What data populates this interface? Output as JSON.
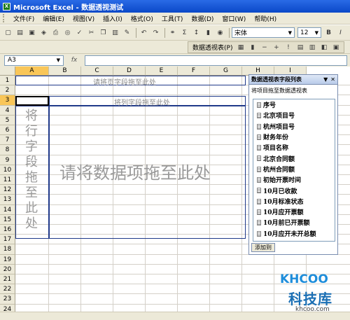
{
  "window": {
    "title": "Microsoft Excel - 数据透视测试"
  },
  "menu": [
    "文件(F)",
    "编辑(E)",
    "视图(V)",
    "插入(I)",
    "格式(O)",
    "工具(T)",
    "数据(D)",
    "窗口(W)",
    "帮助(H)"
  ],
  "toolbar": {
    "font_name": "宋体",
    "font_size": "12",
    "bold": "B",
    "italic": "I",
    "sum": "Σ"
  },
  "pivot_toolbar": {
    "label": "数据透视表(P)"
  },
  "formula_bar": {
    "name_box": "A3",
    "fx": "fx",
    "formula": ""
  },
  "grid": {
    "columns": [
      "A",
      "B",
      "C",
      "D",
      "E",
      "F",
      "G",
      "H",
      "I"
    ],
    "rows": [
      "1",
      "2",
      "3",
      "4",
      "5",
      "6",
      "7",
      "8",
      "9",
      "10",
      "11",
      "12",
      "13",
      "14",
      "15",
      "16",
      "17",
      "18",
      "19",
      "20",
      "21",
      "22",
      "23",
      "24"
    ],
    "active_cell": "A3"
  },
  "pivot_layout": {
    "page_drop_text": "请将页字段拖至此处",
    "column_drop_text": "将列字段拖至此处",
    "row_drop_text": "将行字段拖至此处",
    "data_drop_text": "请将数据项拖至此处"
  },
  "field_list": {
    "title": "数据透视表字段列表",
    "hint": "将项目拖至数据透视表",
    "fields": [
      "序号",
      "北京项目号",
      "杭州项目号",
      "财务年份",
      "项目名称",
      "北京合同额",
      "杭州合同额",
      "初始开票时间",
      "10月已收款",
      "10月标准状态",
      "10月应开票额",
      "10月前已开票额",
      "10月应开未开总额"
    ],
    "add_button": "添加到"
  },
  "watermark": {
    "logo": "KHCOO",
    "name": "科技库",
    "url": "khcoo.com"
  }
}
